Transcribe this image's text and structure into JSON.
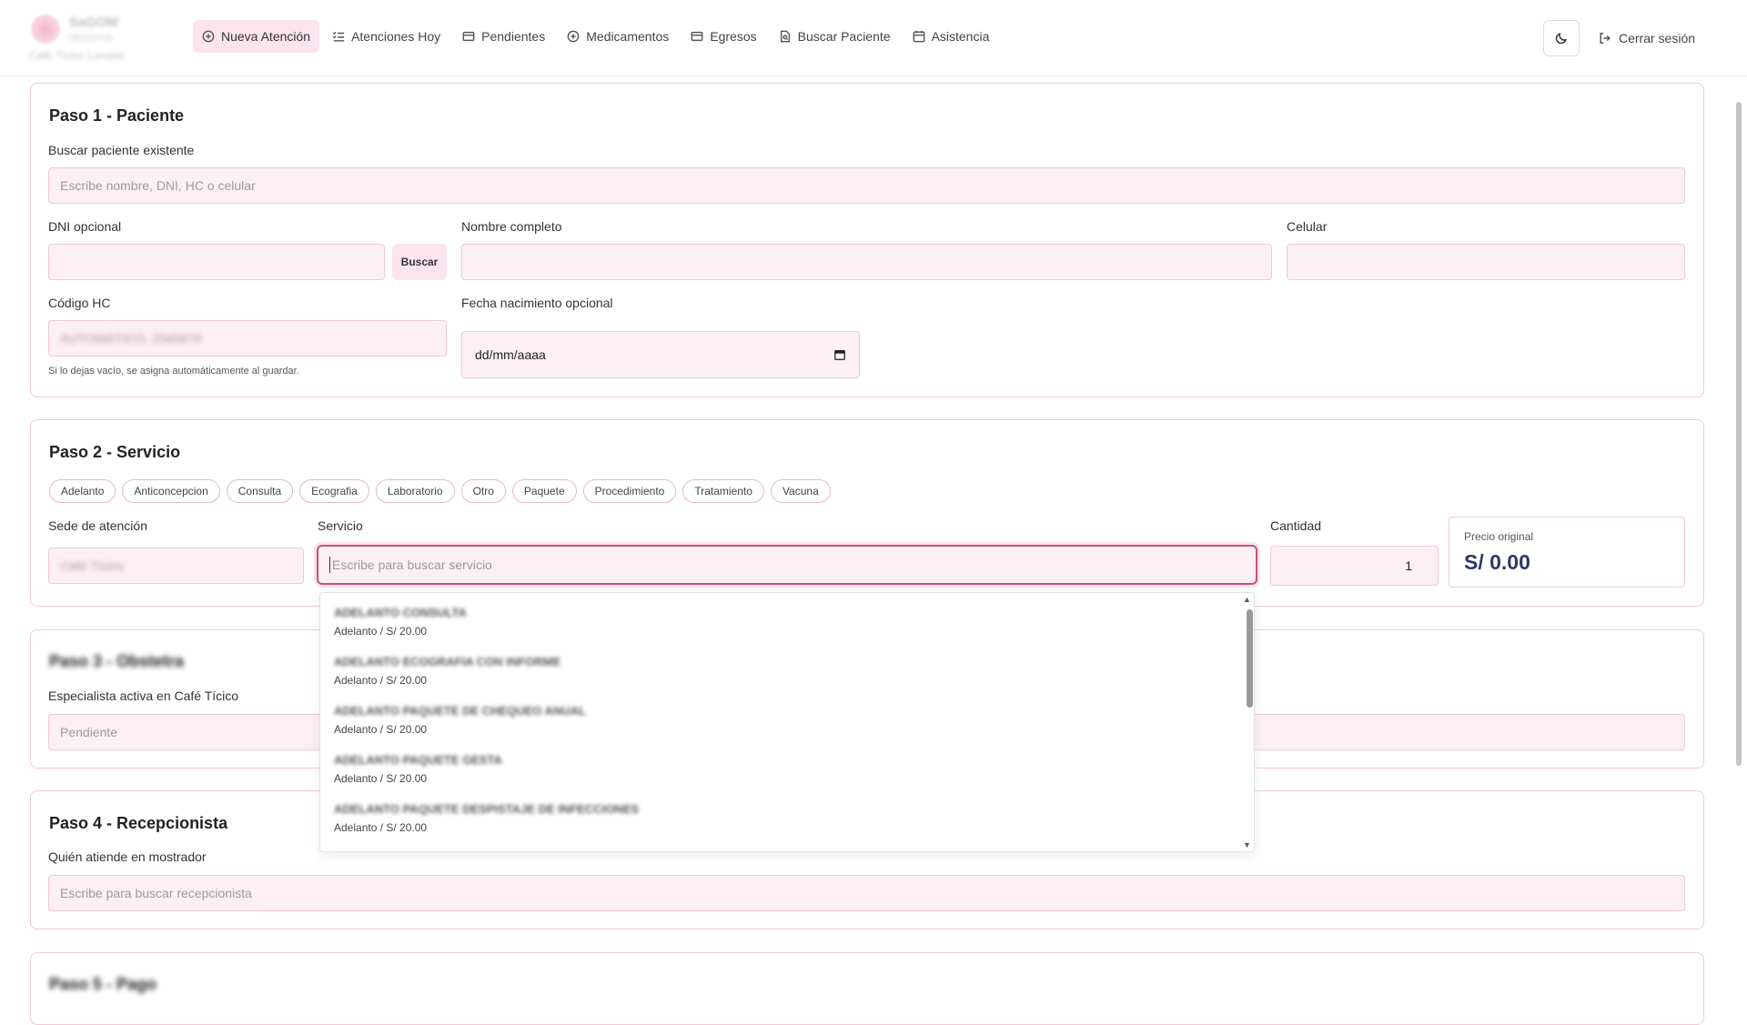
{
  "brand": {
    "name": "SaGOM",
    "subtitle": "Obstetricia",
    "site": "Café Tícico Lunaria"
  },
  "nav": [
    {
      "label": "Nueva Atención",
      "icon": "plus-circle-icon",
      "active": true
    },
    {
      "label": "Atenciones Hoy",
      "icon": "list-check-icon"
    },
    {
      "label": "Pendientes",
      "icon": "card-icon"
    },
    {
      "label": "Medicamentos",
      "icon": "plus-circle-icon"
    },
    {
      "label": "Egresos",
      "icon": "card-icon"
    },
    {
      "label": "Buscar Paciente",
      "icon": "document-search-icon"
    },
    {
      "label": "Asistencia",
      "icon": "calendar-icon"
    }
  ],
  "header": {
    "logout_label": "Cerrar sesión",
    "theme_icon": "moon-icon"
  },
  "step1": {
    "title": "Paso 1 - Paciente",
    "search_label": "Buscar paciente existente",
    "search_placeholder": "Escribe nombre, DNI, HC o celular",
    "dni_label": "DNI opcional",
    "dni_value": "",
    "buscar_label": "Buscar",
    "nombre_label": "Nombre completo",
    "nombre_value": "",
    "celular_label": "Celular",
    "celular_value": "",
    "hc_label": "Código HC",
    "hc_placeholder": "AUTOMÁTICO, 2345678",
    "hc_hint": "Si lo dejas vacío, se asigna automáticamente al guardar.",
    "fecha_label": "Fecha nacimiento opcional",
    "fecha_value": "dd/mm/aaaa"
  },
  "step2": {
    "title": "Paso 2 - Servicio",
    "categories": [
      "Adelanto",
      "Anticoncepcion",
      "Consulta",
      "Ecografia",
      "Laboratorio",
      "Otro",
      "Paquete",
      "Procedimiento",
      "Tratamiento",
      "Vacuna"
    ],
    "sede_label": "Sede de atención",
    "sede_value": "Café Tícico",
    "servicio_label": "Servicio",
    "servicio_placeholder": "Escribe para buscar servicio",
    "cantidad_label": "Cantidad",
    "cantidad_value": "1",
    "precio_label": "Precio original",
    "precio_value": "S/ 0.00",
    "dropdown": [
      {
        "name": "ADELANTO CONSULTA",
        "meta": "Adelanto / S/ 20.00"
      },
      {
        "name": "ADELANTO ECOGRAFIA CON INFORME",
        "meta": "Adelanto / S/ 20.00"
      },
      {
        "name": "ADELANTO PAQUETE DE CHEQUEO ANUAL",
        "meta": "Adelanto / S/ 20.00"
      },
      {
        "name": "ADELANTO PAQUETE GESTA",
        "meta": "Adelanto / S/ 20.00"
      },
      {
        "name": "ADELANTO PAQUETE DESPISTAJE DE INFECCIONES",
        "meta": "Adelanto / S/ 20.00"
      }
    ]
  },
  "step3": {
    "title": "Paso 3 - Obstetra",
    "especialista_label": "Especialista activa en Café Tícico",
    "especialista_value": "Pendiente"
  },
  "step4": {
    "title": "Paso 4 - Recepcionista",
    "quien_label": "Quién atiende en mostrador",
    "quien_placeholder": "Escribe para buscar recepcionista"
  },
  "step5": {
    "title": "Paso 5 - Pago"
  }
}
